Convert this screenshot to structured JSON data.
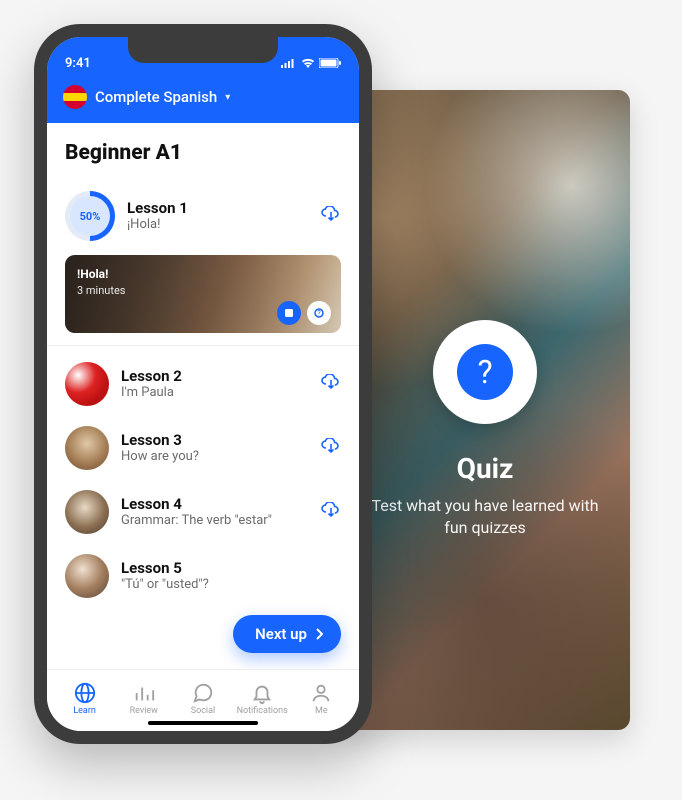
{
  "status": {
    "time": "9:41"
  },
  "course": {
    "name": "Complete Spanish"
  },
  "levelTitle": "Beginner A1",
  "lessons": [
    {
      "title": "Lesson 1",
      "subtitle": "¡Hola!",
      "progress": "50%"
    },
    {
      "title": "Lesson 2",
      "subtitle": "I'm Paula"
    },
    {
      "title": "Lesson 3",
      "subtitle": "How are you?"
    },
    {
      "title": "Lesson 4",
      "subtitle": "Grammar: The verb \"estar\""
    },
    {
      "title": "Lesson 5",
      "subtitle": "\"Tú\" or \"usted\"?"
    }
  ],
  "featuredCard": {
    "title": "!Hola!",
    "duration": "3 minutes"
  },
  "nextUpLabel": "Next up",
  "tabs": {
    "learn": "Learn",
    "review": "Review",
    "social": "Social",
    "notifications": "Notifications",
    "me": "Me"
  },
  "quiz": {
    "title": "Quiz",
    "subtitle": "Test what you have learned with fun quizzes",
    "icon": "?"
  },
  "colors": {
    "accent": "#1764ff"
  }
}
